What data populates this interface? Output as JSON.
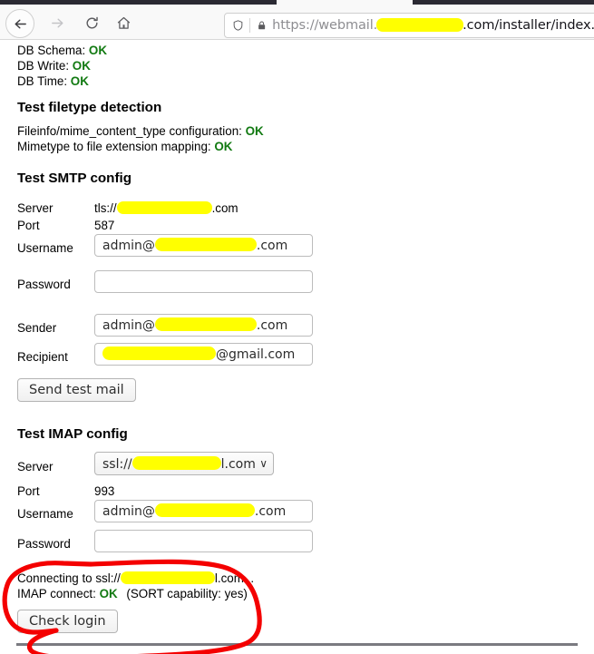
{
  "browser": {
    "back_label": "back-arrow",
    "forward_label": "forward-arrow",
    "reload_label": "reload",
    "home_label": "home",
    "url_prefix": "https://webmail.",
    "url_redacted_domain": "",
    "url_suffix": ".com/installer/index.",
    "shield_icon": "shield-icon",
    "lock_icon": "padlock-icon"
  },
  "db_checks": [
    {
      "label": "DB Schema:",
      "status": "OK"
    },
    {
      "label": "DB Write:",
      "status": "OK"
    },
    {
      "label": "DB Time:",
      "status": "OK"
    }
  ],
  "filetype": {
    "heading": "Test filetype detection",
    "checks": [
      {
        "label": "Fileinfo/mime_content_type configuration:",
        "status": "OK"
      },
      {
        "label": "Mimetype to file extension mapping:",
        "status": "OK"
      }
    ]
  },
  "smtp": {
    "heading": "Test SMTP config",
    "server_label": "Server",
    "server_prefix": "tls://",
    "server_suffix": ".com",
    "port_label": "Port",
    "port_value": "587",
    "username_label": "Username",
    "username_prefix": "admin@",
    "username_suffix": ".com",
    "password_label": "Password",
    "password_value": "",
    "sender_label": "Sender",
    "sender_prefix": "admin@",
    "sender_suffix": ".com",
    "recipient_label": "Recipient",
    "recipient_suffix": "@gmail.com",
    "send_button": "Send test mail"
  },
  "imap": {
    "heading": "Test IMAP config",
    "server_label": "Server",
    "server_prefix": "ssl://",
    "server_suffix": "l.com",
    "server_chevron": "∨",
    "port_label": "Port",
    "port_value": "993",
    "username_label": "Username",
    "username_prefix": "admin@",
    "username_suffix": ".com",
    "password_label": "Password",
    "password_value": "",
    "result_line1_prefix": "Connecting to ssl://",
    "result_line1_suffix": "l.com...",
    "result_line2_label": "IMAP connect:",
    "result_line2_status": "OK",
    "result_line2_note": "(SORT capability: yes)",
    "check_button": "Check login"
  },
  "colors": {
    "ok_green": "#127a12",
    "redaction_yellow": "#ffff00",
    "annotation_red": "#f40000"
  }
}
